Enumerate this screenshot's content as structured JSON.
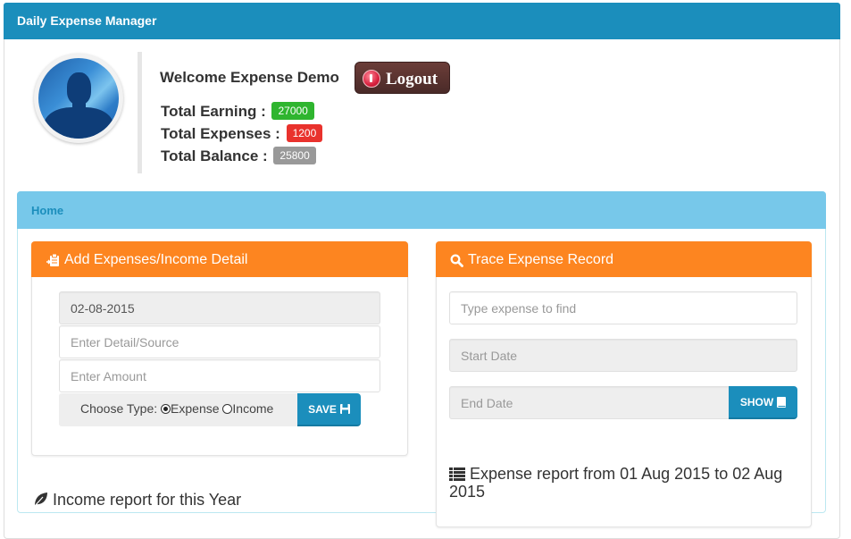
{
  "app": {
    "title": "Daily Expense Manager"
  },
  "profile": {
    "avatar_icon": "user-silhouette-icon",
    "welcome_text": "Welcome Expense Demo",
    "logout_label": "Logout",
    "stats": [
      {
        "label": "Total Earning :",
        "value": "27000",
        "color": "#2fb52f"
      },
      {
        "label": "Total Expenses :",
        "value": "1200",
        "color": "#e9322d"
      },
      {
        "label": "Total Balance :",
        "value": "25800",
        "color": "#999999"
      }
    ]
  },
  "home": {
    "title": "Home"
  },
  "add_panel": {
    "title": "Add Expenses/Income Detail",
    "date_value": "02-08-2015",
    "detail_placeholder": "Enter Detail/Source",
    "amount_placeholder": "Enter Amount",
    "choose_type_label": "Choose Type:",
    "type_options": [
      {
        "label": "Expense",
        "selected": true
      },
      {
        "label": "Income",
        "selected": false
      }
    ],
    "save_label": "SAVE"
  },
  "trace_panel": {
    "title": "Trace Expense Record",
    "search_placeholder": "Type expense to find",
    "start_date_placeholder": "Start Date",
    "end_date_placeholder": "End Date",
    "show_label": "SHOW"
  },
  "reports": {
    "income_title": "Income report for this Year",
    "expense_title": "Expense report from 01 Aug 2015 to 02 Aug 2015"
  },
  "colors": {
    "primary": "#1b8ebc",
    "info_header": "#77c8ea",
    "warning_header": "#fd8520",
    "logout": "#5a3330"
  }
}
